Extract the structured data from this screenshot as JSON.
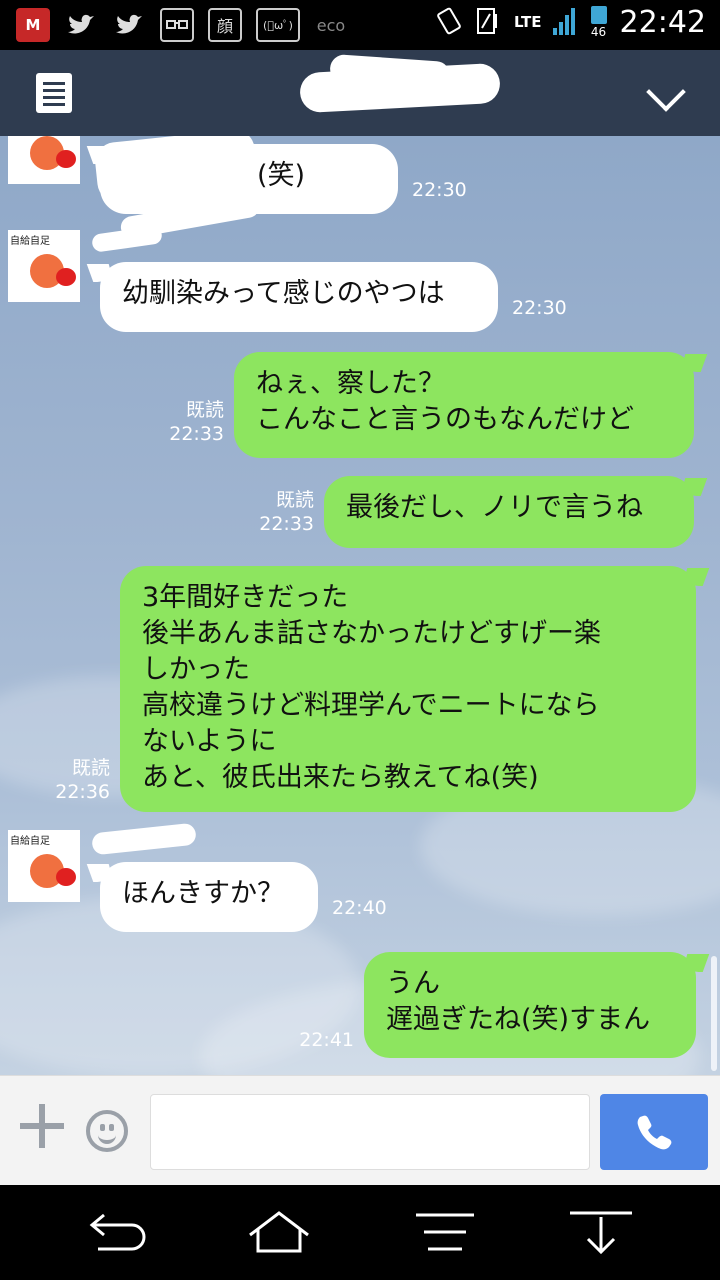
{
  "status_bar": {
    "left_icons": [
      "mcafee-icon",
      "twitter-icon",
      "twitter-icon",
      "glasses-icon",
      "face-kanji-icon",
      "emoticon-icon",
      "eco-icon"
    ],
    "face_kanji": "顔",
    "emoticon": "(ﾟωﾟ)",
    "eco": "eco",
    "network": "LTE",
    "battery": "46",
    "time": "22:42"
  },
  "messages": [
    {
      "side": "left",
      "text": "ーーかだわ(笑)",
      "time": "22:30"
    },
    {
      "side": "left",
      "text": "幼馴染みって感じのやつは",
      "time": "22:30"
    },
    {
      "side": "right",
      "text": "ねぇ、察した？\nこんなこと言うのもなんだけど",
      "read": "既読",
      "time": "22:33"
    },
    {
      "side": "right",
      "text": "最後だし、ノリで言うね",
      "read": "既読",
      "time": "22:33"
    },
    {
      "side": "right",
      "text": "3年間好きだった\n後半あんま話さなかったけどすげー楽\nしかった\n高校違うけど料理学んでニートになら\nないように\nあと、彼氏出来たら教えてね(笑)",
      "read": "既読",
      "time": "22:36"
    },
    {
      "side": "left",
      "text": "ほんきすか？",
      "time": "22:40"
    },
    {
      "side": "right",
      "text": "うん\n遅過ぎたね(笑)すまん",
      "time": "22:41"
    }
  ],
  "avatar_caption": "自給自足",
  "input": {
    "value": "",
    "placeholder": ""
  },
  "colors": {
    "header": "#2f3c50",
    "bubble_right": "#8de55f",
    "bubble_left": "#ffffff",
    "call_button": "#4f86e6"
  }
}
